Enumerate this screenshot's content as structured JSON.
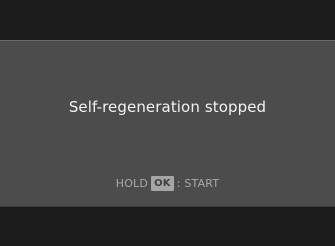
{
  "message": {
    "text": "Self-regeneration stopped"
  },
  "hint": {
    "prefix": "HOLD",
    "key_label": "OK",
    "suffix": ": START"
  },
  "colors": {
    "panel": "#4c4c4c",
    "band": "#1c1c1c",
    "message_text": "#f2f2f2",
    "hint_text": "#a9a9a9",
    "key_background": "#a5a5a5"
  }
}
